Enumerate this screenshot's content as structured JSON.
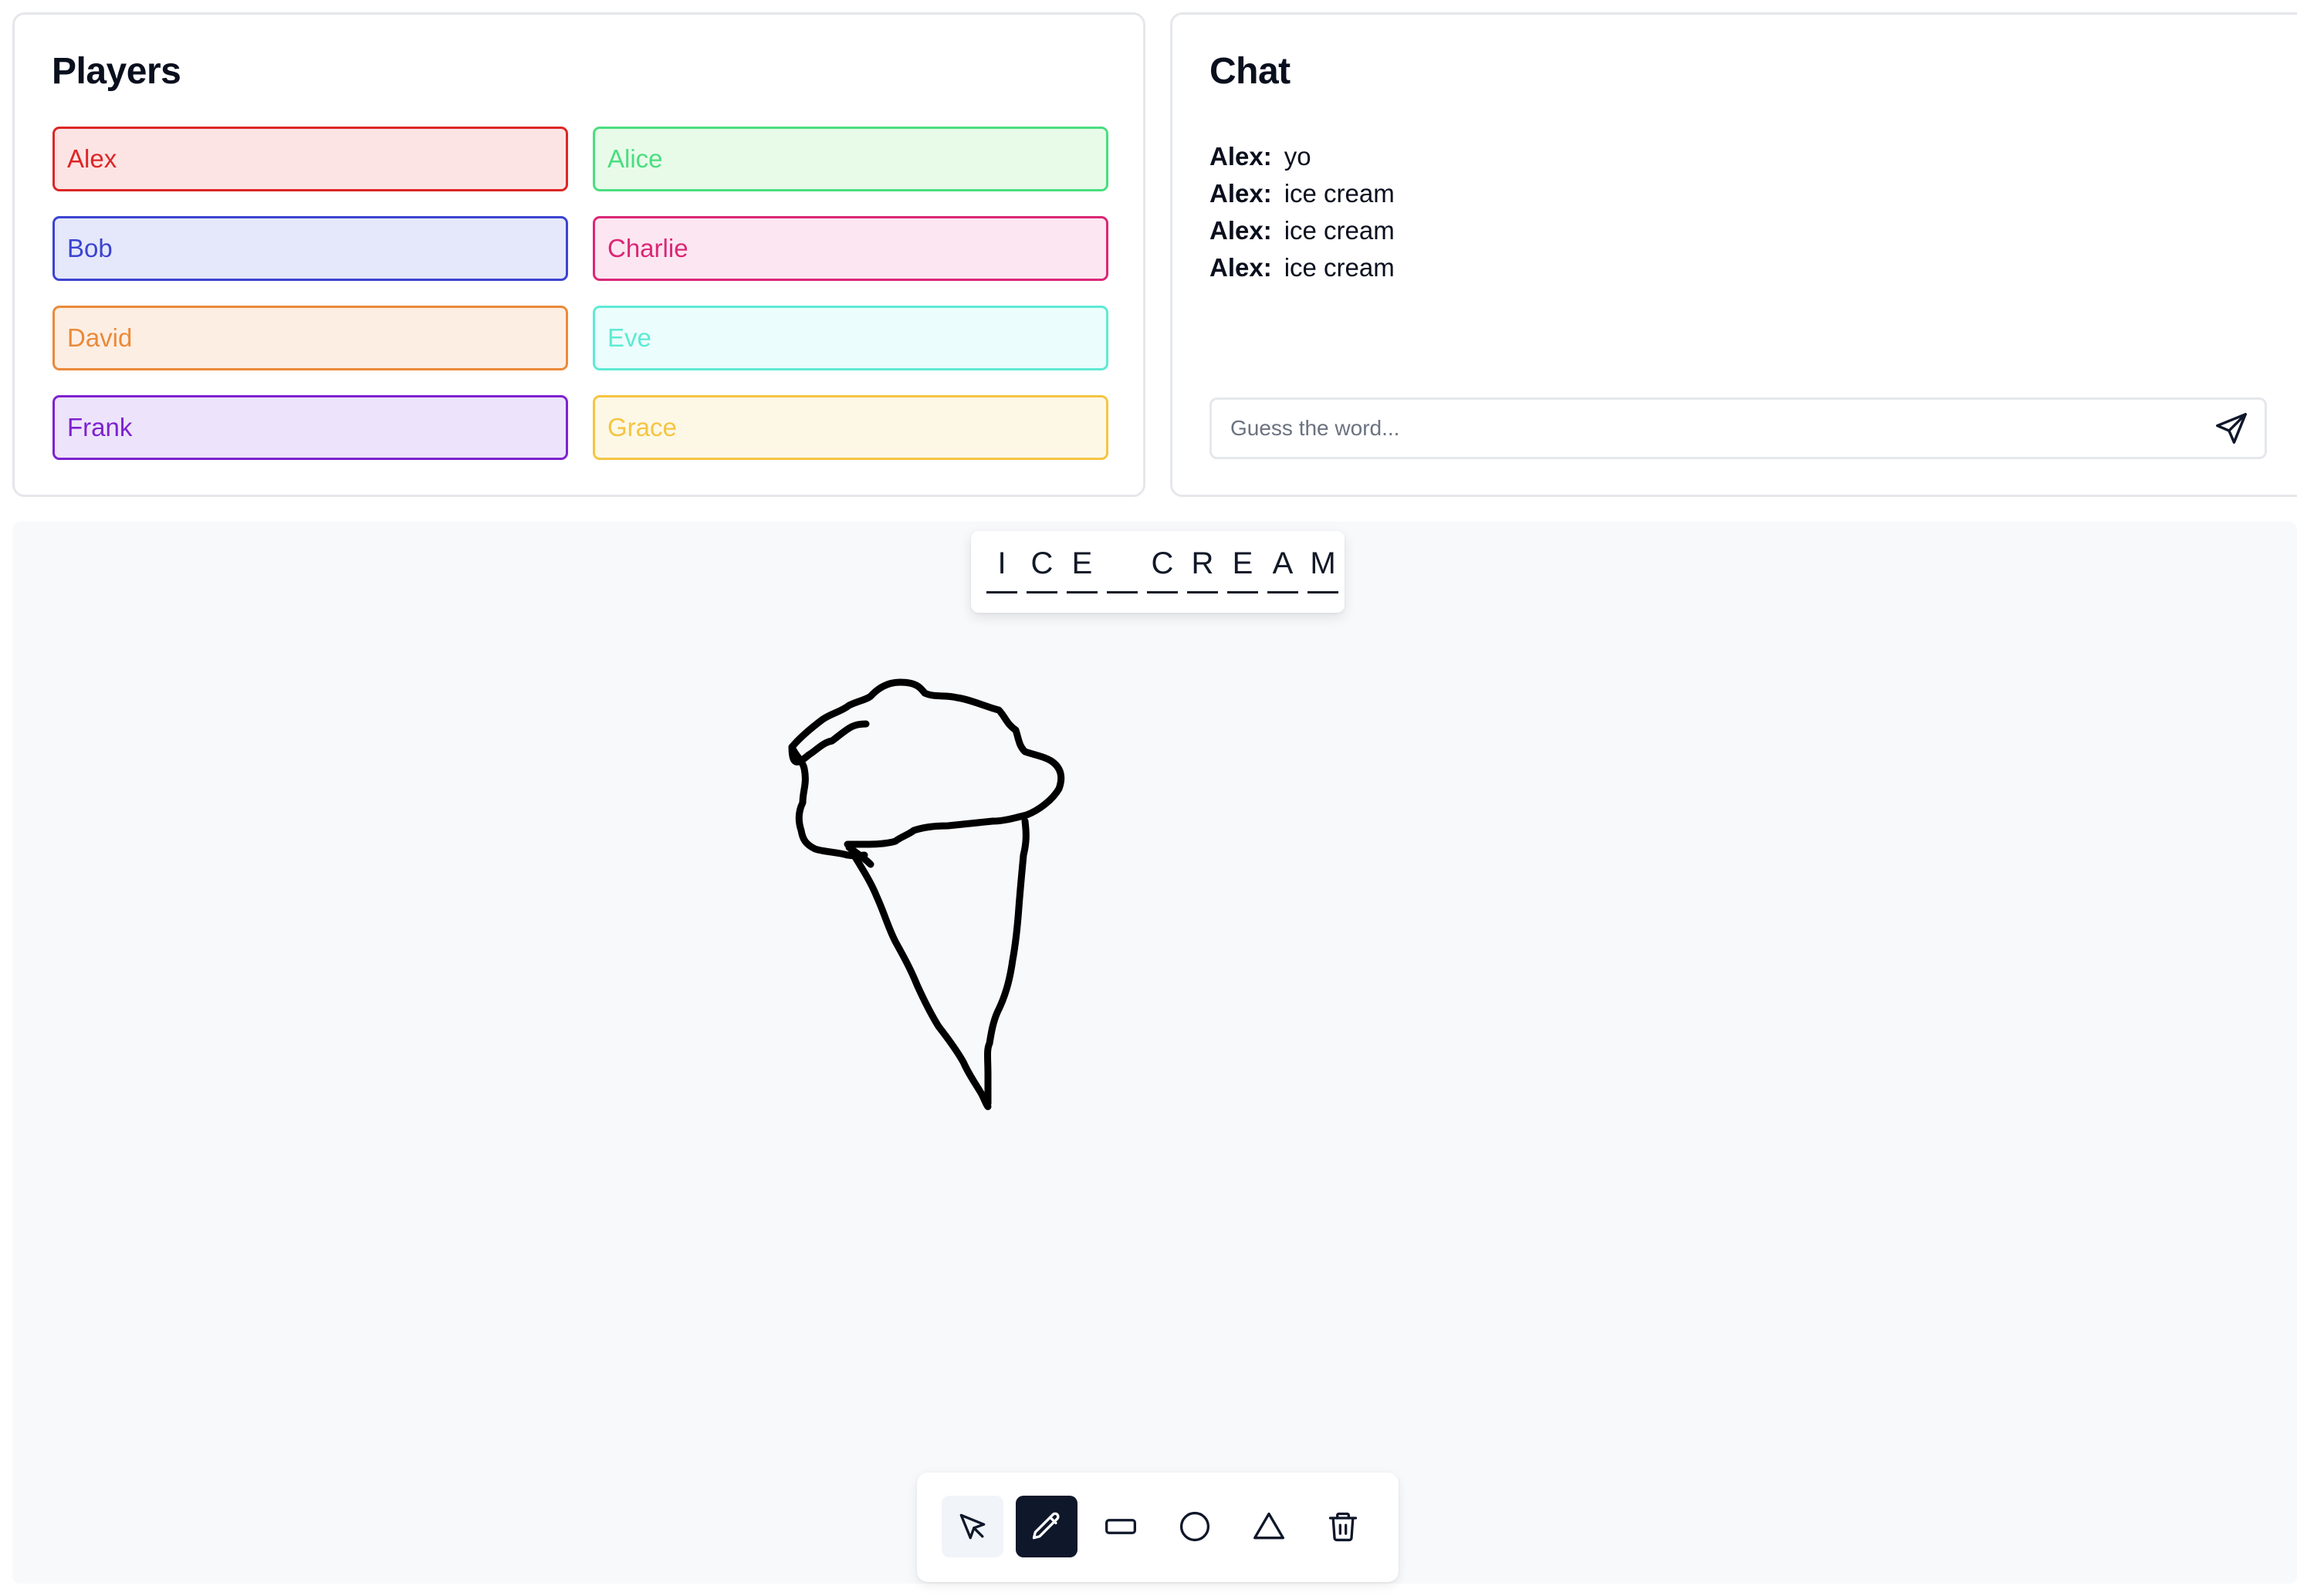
{
  "players_panel": {
    "title": "Players",
    "players": [
      {
        "name": "Alex",
        "color": "#dc2626",
        "bg": "#fde4e4"
      },
      {
        "name": "Alice",
        "color": "#4ade80",
        "bg": "#e8fbe9"
      },
      {
        "name": "Bob",
        "color": "#3b44d1",
        "bg": "#e5e8fb"
      },
      {
        "name": "Charlie",
        "color": "#db2777",
        "bg": "#fce6f1"
      },
      {
        "name": "David",
        "color": "#ea8a3a",
        "bg": "#fdeee4"
      },
      {
        "name": "Eve",
        "color": "#5eead4",
        "bg": "#ebfdfc"
      },
      {
        "name": "Frank",
        "color": "#7e22ce",
        "bg": "#ede4fb"
      },
      {
        "name": "Grace",
        "color": "#f5c542",
        "bg": "#fdf8e6"
      }
    ]
  },
  "chat_panel": {
    "title": "Chat",
    "messages": [
      {
        "author": "Alex:",
        "text": "yo"
      },
      {
        "author": "Alex:",
        "text": "ice cream"
      },
      {
        "author": "Alex:",
        "text": "ice cream"
      },
      {
        "author": "Alex:",
        "text": "ice cream"
      }
    ],
    "input": {
      "placeholder": "Guess the word...",
      "value": ""
    },
    "send_icon": "send-icon"
  },
  "word_hint": {
    "letters": [
      "I",
      "C",
      "E",
      "",
      "C",
      "R",
      "E",
      "A",
      "M"
    ]
  },
  "canvas": {
    "drawing": "ice-cream-cone-sketch",
    "stroke_color": "#000000",
    "background": "#f8f9fb"
  },
  "toolbar": {
    "active_tool": "pencil",
    "tools": [
      {
        "id": "select",
        "icon": "cursor-icon"
      },
      {
        "id": "pencil",
        "icon": "pencil-icon"
      },
      {
        "id": "rectangle",
        "icon": "rectangle-icon"
      },
      {
        "id": "circle",
        "icon": "circle-icon"
      },
      {
        "id": "triangle",
        "icon": "triangle-icon"
      },
      {
        "id": "clear",
        "icon": "trash-icon"
      }
    ]
  }
}
